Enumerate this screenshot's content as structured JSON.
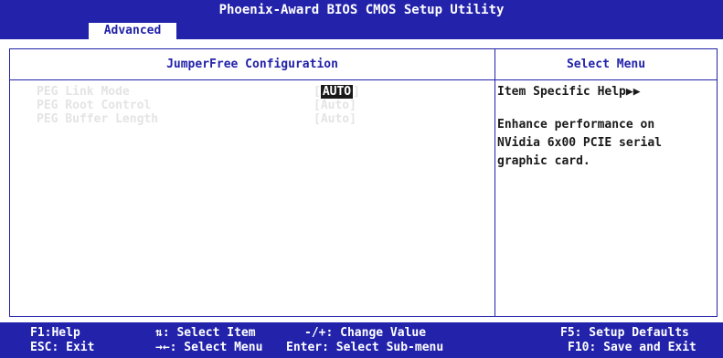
{
  "title": "Phoenix-Award BIOS CMOS Setup Utility",
  "menu_tab": "Advanced",
  "left_panel": {
    "title": "JumperFree Configuration",
    "items": [
      {
        "label": "PEG Link Mode",
        "open": "[",
        "value": "AUTO",
        "close": "]",
        "selected": true
      },
      {
        "label": "PEG Root Control",
        "open": "[",
        "value": "Auto",
        "close": "]",
        "selected": false
      },
      {
        "label": "PEG Buffer Length",
        "open": "[",
        "value": "Auto",
        "close": "]",
        "selected": false
      }
    ]
  },
  "right_panel": {
    "title": "Select Menu",
    "help_heading": "Item Specific Help",
    "help_arrow": "▶▶",
    "help_text": "Enhance performance on NVidia 6x00 PCIE serial graphic card."
  },
  "footer": {
    "f1": "F1:Help",
    "esc": "ESC: Exit",
    "updown": "⇅: Select Item",
    "leftright": "→←: Select Menu",
    "plusminus": "-/+: Change Value",
    "enter": "Enter: Select Sub-menu",
    "f5": "F5: Setup Defaults",
    "f10": "F10: Save and Exit"
  },
  "colors": {
    "bios_blue": "#2222aa",
    "item_gray": "#e4e4e4",
    "text_dark": "#1a1a1a"
  }
}
